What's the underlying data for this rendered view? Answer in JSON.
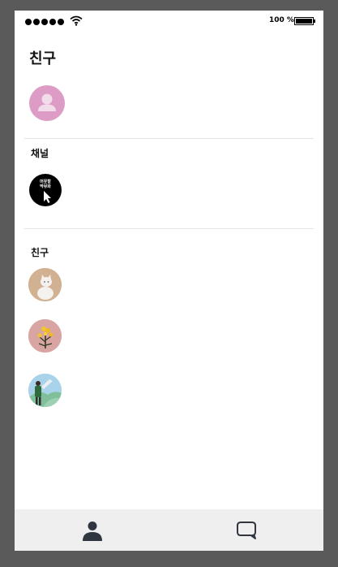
{
  "status_bar": {
    "battery_percent": "100 %"
  },
  "header": {
    "title": "친구"
  },
  "sections": {
    "channel_label": "채널",
    "friends_label": "친구"
  },
  "channel": {
    "logo_text_line1": "머뭇할",
    "logo_text_line2": "딱뮤화"
  },
  "icons": {
    "profile": "person-icon",
    "tab_friends": "person-icon",
    "tab_chat": "chat-bubble-icon"
  },
  "colors": {
    "profile_avatar_bg": "#dc9cc6",
    "tabbar_bg": "#efefef",
    "icon_dark": "#2f3640"
  }
}
